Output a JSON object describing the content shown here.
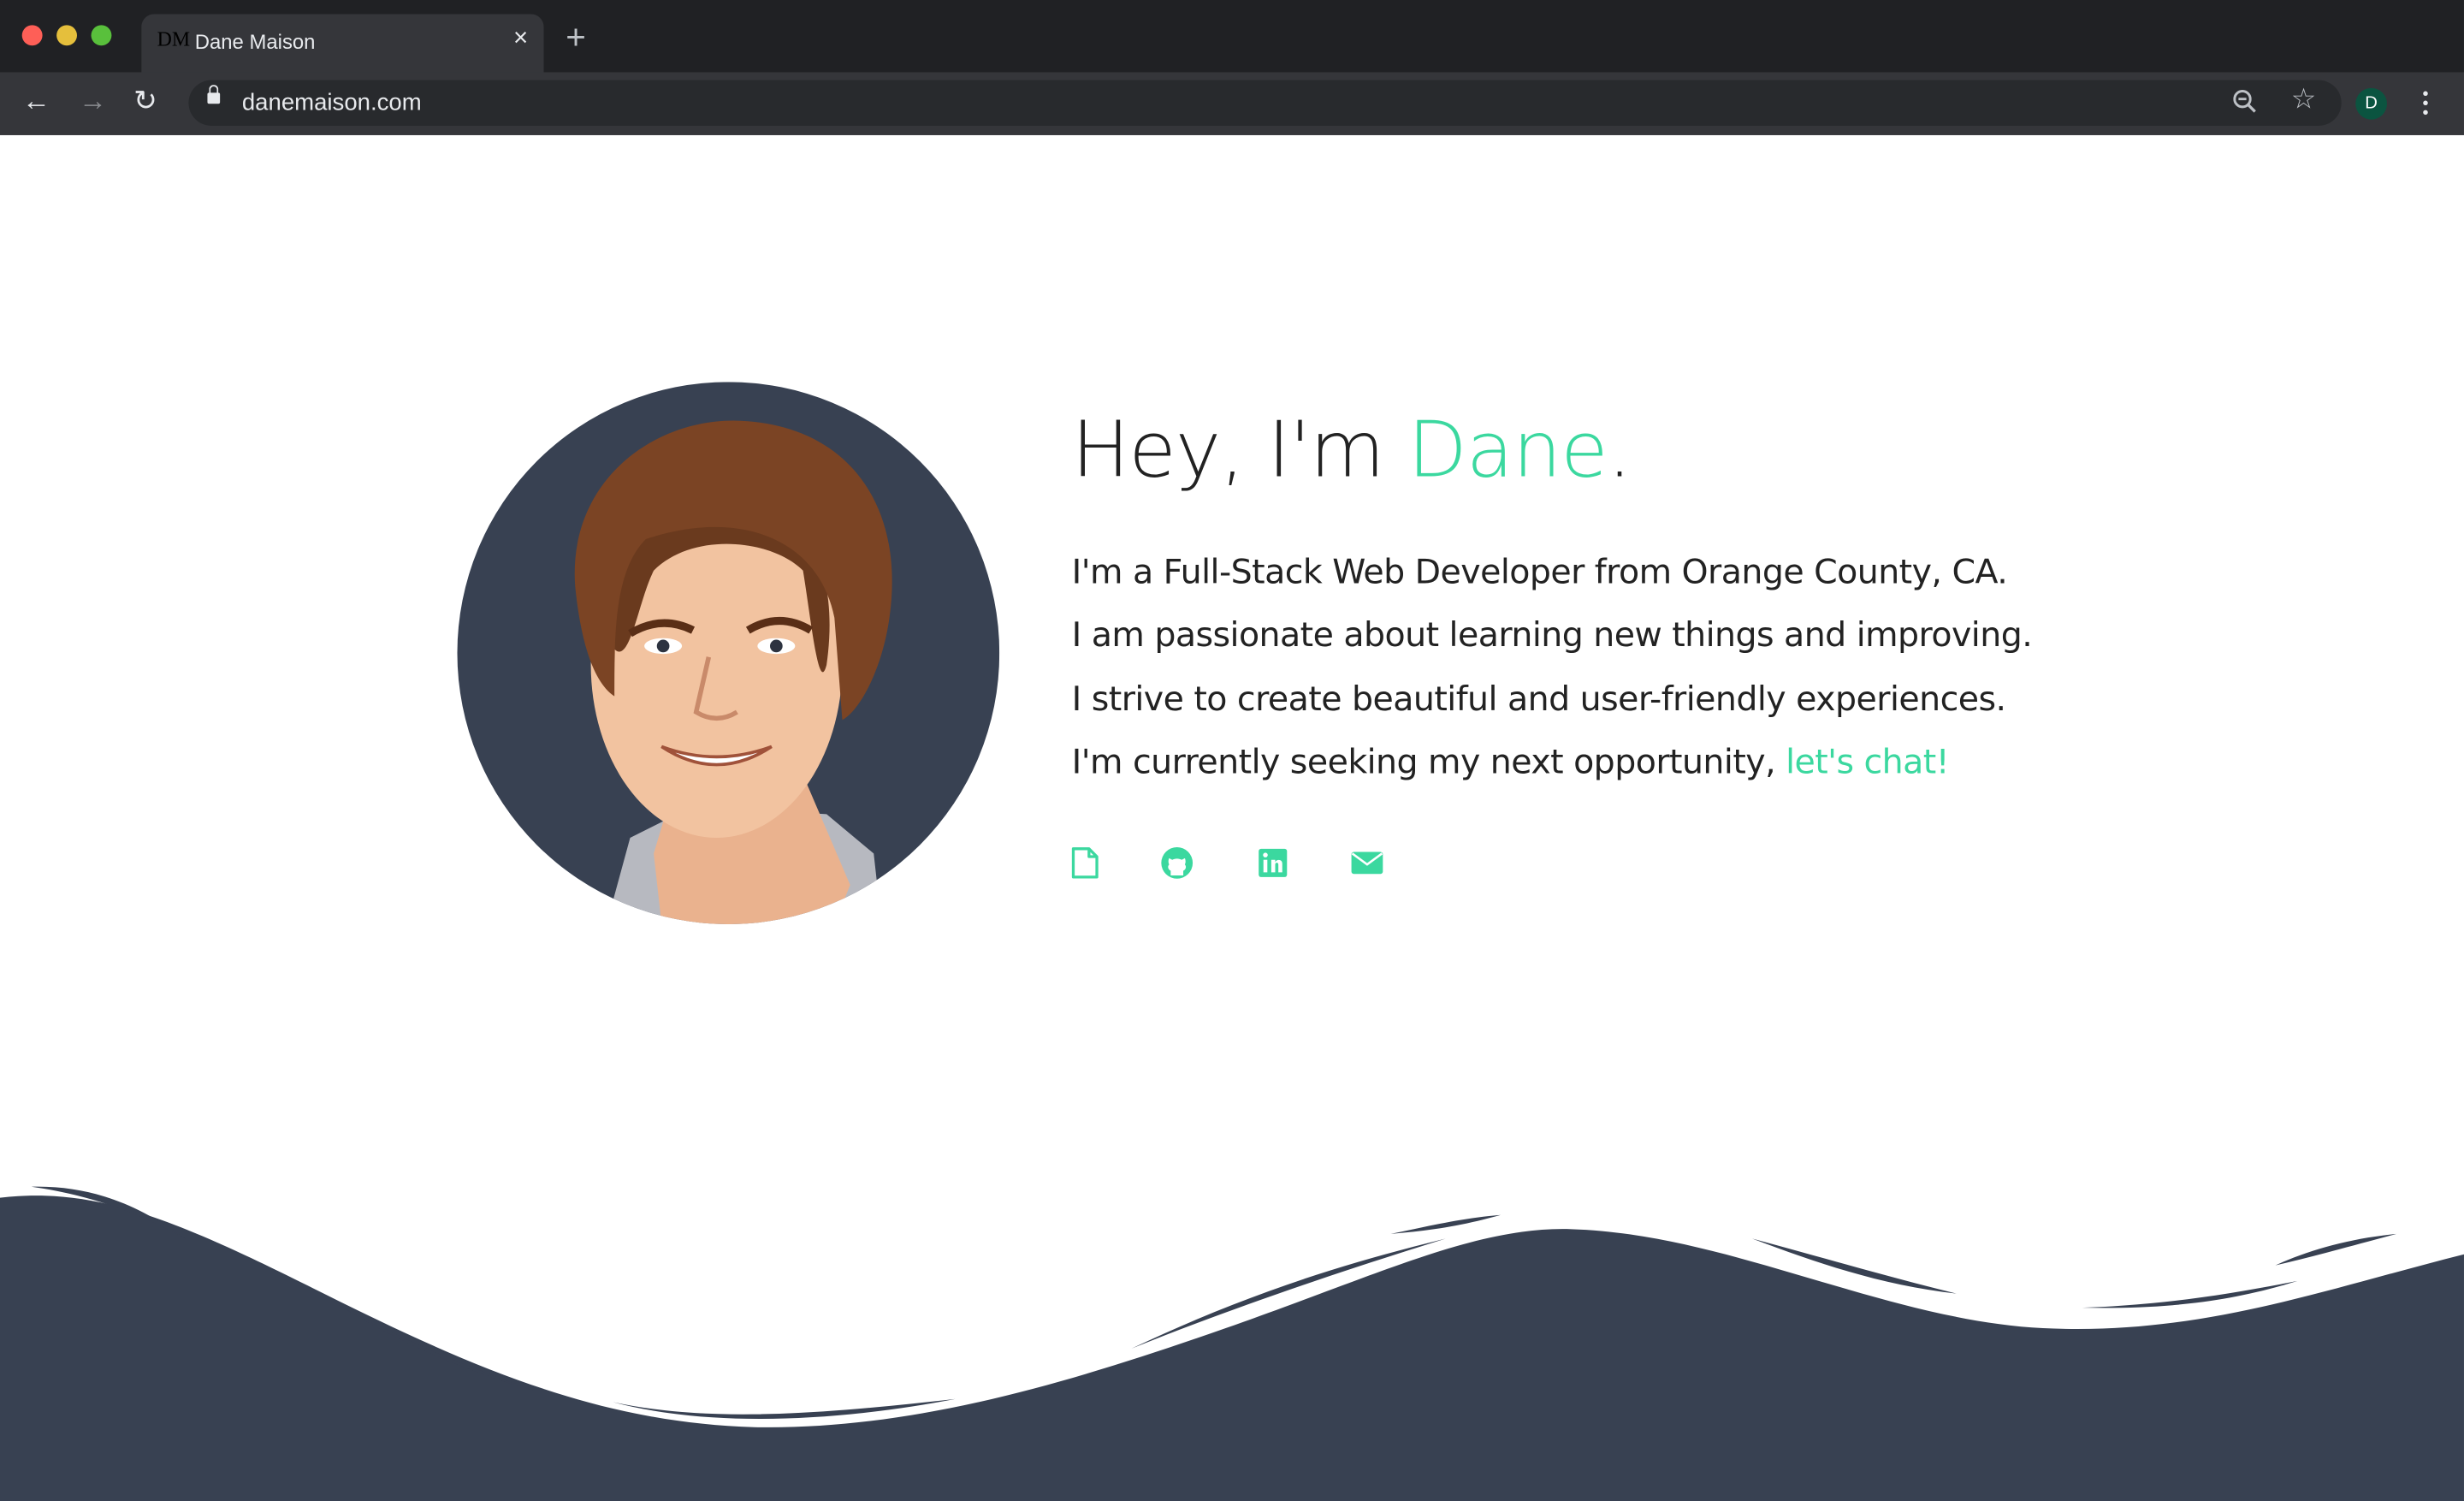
{
  "browser": {
    "tab_title": "Dane Maison",
    "favicon_text": "DM",
    "close_label": "×",
    "new_tab_label": "+",
    "url": "danemaison.com",
    "profile_initial": "D"
  },
  "hero": {
    "greeting": "Hey, I'm ",
    "name": "Dane",
    "period": ".",
    "lines": [
      "I'm a Full-Stack Web Developer from Orange County, CA.",
      "I am passionate about learning new things and improving.",
      "I strive to create beautiful and user-friendly experiences.",
      "I'm currently seeking my next opportunity, "
    ],
    "cta": "let's chat!"
  },
  "social": [
    "resume-icon",
    "github-icon",
    "linkedin-icon",
    "email-icon"
  ],
  "colors": {
    "accent": "#3bd89f",
    "navy": "#384152"
  }
}
